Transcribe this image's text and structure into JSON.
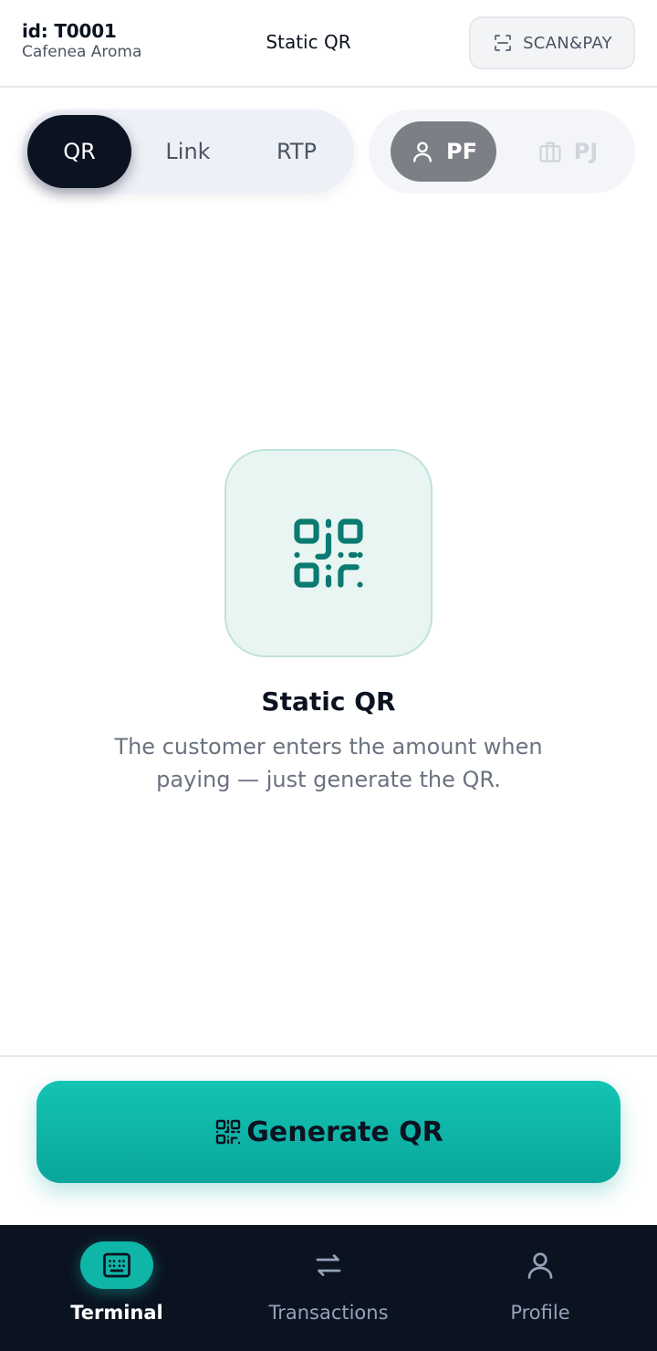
{
  "header": {
    "terminal_id": "id: T0001",
    "merchant_name": "Cafenea Aroma",
    "title": "Static QR",
    "scanpay_label": "SCAN&PAY"
  },
  "mode_tabs": [
    {
      "label": "QR",
      "active": true
    },
    {
      "label": "Link",
      "active": false
    },
    {
      "label": "RTP",
      "active": false
    }
  ],
  "entity_tabs": [
    {
      "label": "PF",
      "active": true,
      "icon": "person-icon"
    },
    {
      "label": "PJ",
      "active": false,
      "icon": "briefcase-icon"
    }
  ],
  "main": {
    "title": "Static QR",
    "description": "The customer enters the amount when paying — just generate the QR."
  },
  "action": {
    "generate_label": "Generate QR"
  },
  "nav": [
    {
      "label": "Terminal",
      "active": true,
      "icon": "keypad-icon"
    },
    {
      "label": "Transactions",
      "active": false,
      "icon": "swap-arrows-icon"
    },
    {
      "label": "Profile",
      "active": false,
      "icon": "person-icon"
    }
  ],
  "colors": {
    "accent": "#0fb5a6",
    "dark": "#0b1220",
    "tile_bg": "#e8f5f2"
  }
}
